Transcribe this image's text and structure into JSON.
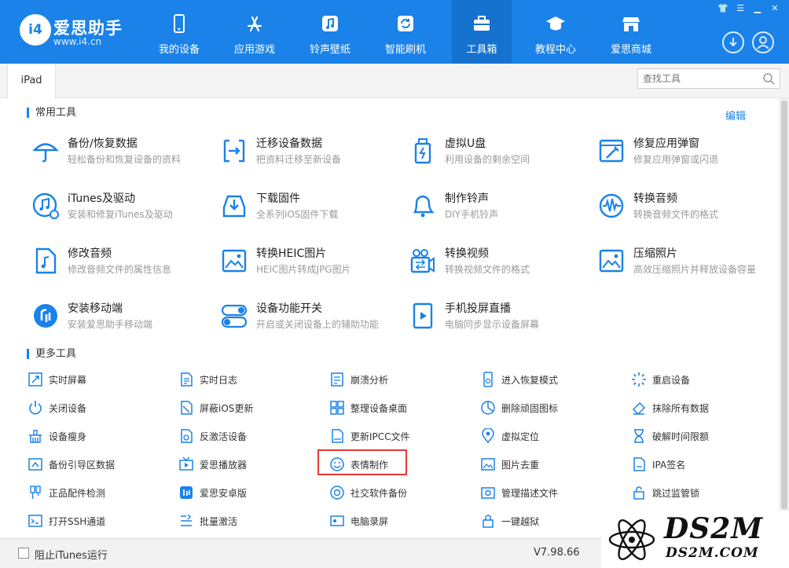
{
  "app": {
    "name": "爱思助手",
    "url": "www.i4.cn",
    "logo_letters": "i4"
  },
  "nav": [
    {
      "label": "我的设备",
      "icon": "phone-icon"
    },
    {
      "label": "应用游戏",
      "icon": "app-store-icon"
    },
    {
      "label": "铃声壁纸",
      "icon": "music-note-icon"
    },
    {
      "label": "智能刷机",
      "icon": "refresh-icon"
    },
    {
      "label": "工具箱",
      "icon": "toolbox-icon",
      "active": true
    },
    {
      "label": "教程中心",
      "icon": "graduation-cap-icon"
    },
    {
      "label": "爱思商城",
      "icon": "shop-icon"
    }
  ],
  "window_controls": [
    "shirt-icon",
    "menu-icon",
    "minimize-icon",
    "close-icon"
  ],
  "tabbar": {
    "tab": "iPad",
    "search_placeholder": "查找工具"
  },
  "common": {
    "title": "常用工具",
    "edit": "编辑",
    "tools": [
      {
        "name": "备份/恢复数据",
        "desc": "轻松备份和恢复设备的资料",
        "icon": "umbrella-icon"
      },
      {
        "name": "迁移设备数据",
        "desc": "把资料迁移至新设备",
        "icon": "migrate-icon"
      },
      {
        "name": "虚拟U盘",
        "desc": "利用设备的剩余空间",
        "icon": "usb-drive-icon"
      },
      {
        "name": "修复应用弹窗",
        "desc": "修复应用弹窗或闪退",
        "icon": "repair-window-icon"
      },
      {
        "name": "iTunes及驱动",
        "desc": "安装和修复iTunes及驱动",
        "icon": "itunes-icon"
      },
      {
        "name": "下载固件",
        "desc": "全系列iOS固件下载",
        "icon": "download-tray-icon"
      },
      {
        "name": "制作铃声",
        "desc": "DIY手机铃声",
        "icon": "bell-icon"
      },
      {
        "name": "转换音频",
        "desc": "转换音频文件的格式",
        "icon": "audio-wave-icon"
      },
      {
        "name": "修改音频",
        "desc": "修改音频文件的属性信息",
        "icon": "audio-file-icon"
      },
      {
        "name": "转换HEIC图片",
        "desc": "HEIC图片转成JPG图片",
        "icon": "image-convert-icon"
      },
      {
        "name": "转换视频",
        "desc": "转换视频文件的格式",
        "icon": "video-convert-icon"
      },
      {
        "name": "压缩照片",
        "desc": "高效压缩照片并释放设备容量",
        "icon": "photo-compress-icon"
      },
      {
        "name": "安装移动端",
        "desc": "安装爱思助手移动端",
        "icon": "i4-mobile-icon"
      },
      {
        "name": "设备功能开关",
        "desc": "开启或关闭设备上的辅助功能",
        "icon": "toggle-switch-icon"
      },
      {
        "name": "手机投屏直播",
        "desc": "电脑同步显示设备屏幕",
        "icon": "screen-cast-icon"
      }
    ]
  },
  "more": {
    "title": "更多工具",
    "tools": [
      {
        "label": "实时屏幕",
        "icon": "realtime-screen-icon"
      },
      {
        "label": "实时日志",
        "icon": "log-icon"
      },
      {
        "label": "崩溃分析",
        "icon": "crash-analysis-icon"
      },
      {
        "label": "进入恢复模式",
        "icon": "recovery-mode-icon"
      },
      {
        "label": "重启设备",
        "icon": "restart-icon"
      },
      {
        "label": "关闭设备",
        "icon": "power-icon"
      },
      {
        "label": "屏蔽iOS更新",
        "icon": "block-update-icon"
      },
      {
        "label": "整理设备桌面",
        "icon": "grid-icon"
      },
      {
        "label": "删除顽固图标",
        "icon": "delete-icon-icon"
      },
      {
        "label": "抹除所有数据",
        "icon": "eraser-icon"
      },
      {
        "label": "设备瘦身",
        "icon": "broom-icon"
      },
      {
        "label": "反激活设备",
        "icon": "deactivate-icon"
      },
      {
        "label": "更新IPCC文件",
        "icon": "ipcc-file-icon"
      },
      {
        "label": "虚拟定位",
        "icon": "location-pin-icon"
      },
      {
        "label": "破解时间限额",
        "icon": "hourglass-icon"
      },
      {
        "label": "备份引导区数据",
        "icon": "boot-backup-icon"
      },
      {
        "label": "爱思播放器",
        "icon": "tv-player-icon"
      },
      {
        "label": "表情制作",
        "icon": "smiley-icon"
      },
      {
        "label": "图片去重",
        "icon": "image-dedupe-icon"
      },
      {
        "label": "IPA签名",
        "icon": "ipa-sign-icon"
      },
      {
        "label": "正品配件检测",
        "icon": "cable-check-icon"
      },
      {
        "label": "爱思安卓版",
        "icon": "i4-android-icon"
      },
      {
        "label": "社交软件备份",
        "icon": "social-backup-icon"
      },
      {
        "label": "管理描述文件",
        "icon": "profile-gear-icon"
      },
      {
        "label": "跳过监管锁",
        "icon": "skip-lock-icon"
      },
      {
        "label": "打开SSH通道",
        "icon": "terminal-icon"
      },
      {
        "label": "批量激活",
        "icon": "batch-activate-icon"
      },
      {
        "label": "电脑录屏",
        "icon": "screen-record-icon"
      },
      {
        "label": "一键越狱",
        "icon": "jailbreak-lock-icon"
      }
    ]
  },
  "footer": {
    "checkbox_label": "阻止iTunes运行",
    "version": "V7.98.66"
  },
  "watermark": {
    "main": "DS2M",
    "sub": "DS2M.COM"
  },
  "colors": {
    "header_blue": "#1a82e8",
    "icon_blue": "#1a82e8",
    "highlight_red": "#e53935"
  }
}
